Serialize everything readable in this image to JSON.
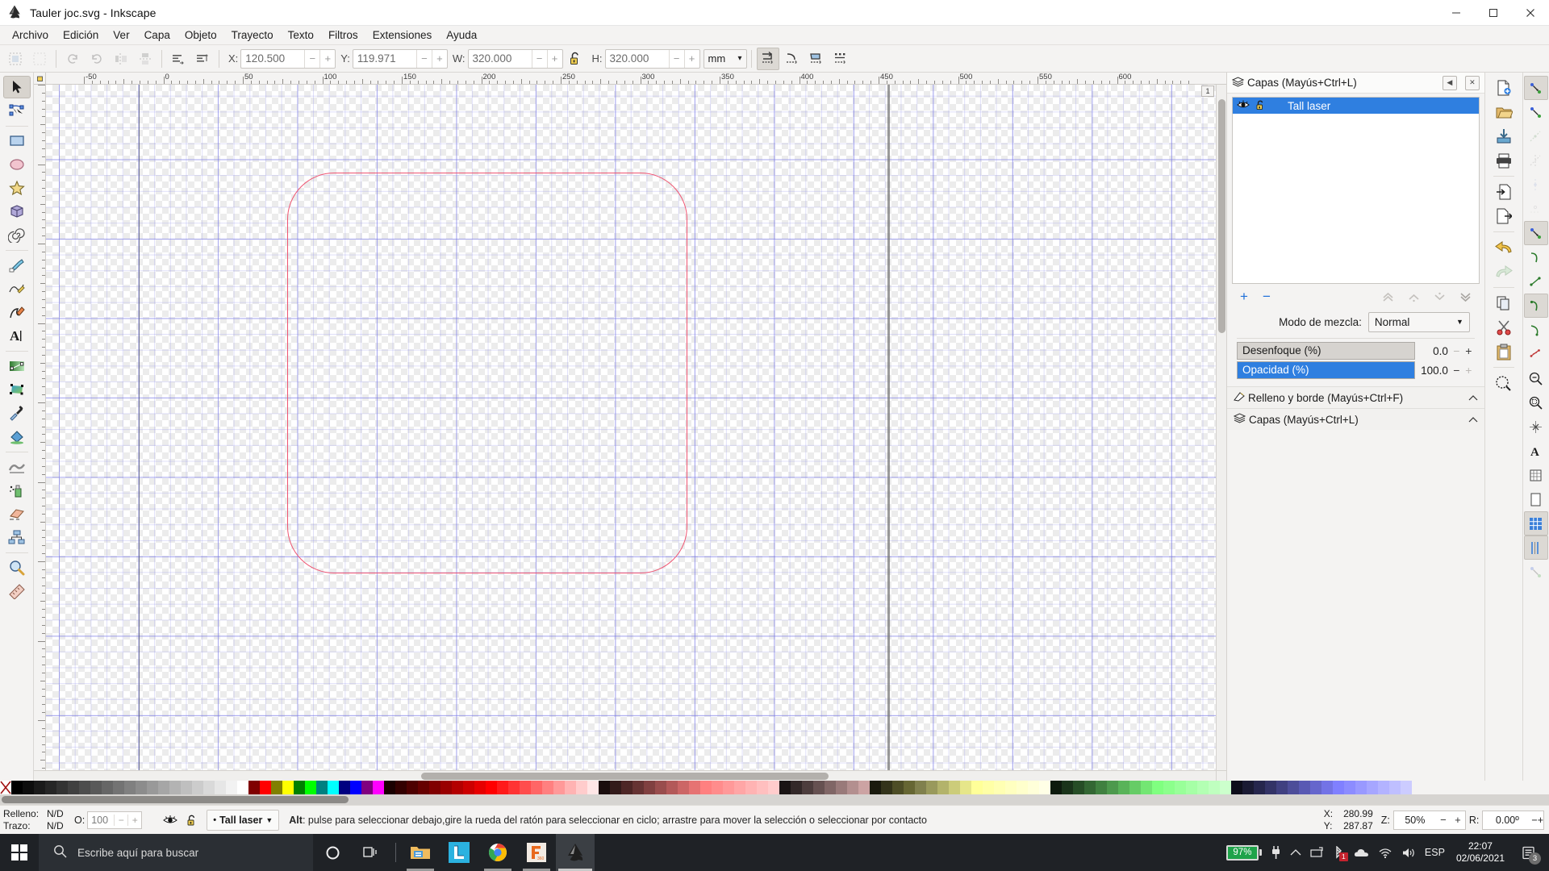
{
  "window": {
    "title": "Tauler joc.svg - Inkscape",
    "app_icon": "inkscape-logo-icon",
    "minimize": "—",
    "maximize": "▢",
    "close": "✕"
  },
  "menubar": {
    "items": [
      "Archivo",
      "Edición",
      "Ver",
      "Capa",
      "Objeto",
      "Trayecto",
      "Texto",
      "Filtros",
      "Extensiones",
      "Ayuda"
    ]
  },
  "toolcontrols": {
    "align_left_icon": "align-nodes-left-icon",
    "align_top_icon": "align-nodes-top-icon",
    "x_label": "X:",
    "x_value": "120.500",
    "y_label": "Y:",
    "y_value": "119.971",
    "w_label": "W:",
    "w_value": "320.000",
    "h_label": "H:",
    "h_value": "320.000",
    "lock_icon": "lock-open-icon",
    "units": "mm",
    "units_caret": "▾",
    "minus": "−",
    "plus": "+",
    "snap_buttons": [
      {
        "name": "snap-bounding-box-icon",
        "active": true
      },
      {
        "name": "snap-bbox-corner-icon",
        "active": false
      },
      {
        "name": "snap-bbox-edge-icon",
        "active": false
      },
      {
        "name": "snap-bbox-midpoint-icon",
        "active": false
      }
    ]
  },
  "toolbox": {
    "tools": [
      {
        "name": "selector-tool",
        "icon": "arrow-cursor-icon",
        "selected": true
      },
      {
        "name": "node-tool",
        "icon": "node-editor-icon",
        "selected": false
      },
      {
        "name": "rectangle-tool",
        "icon": "rectangle-icon",
        "selected": false
      },
      {
        "name": "ellipse-tool",
        "icon": "ellipse-icon",
        "selected": false
      },
      {
        "name": "star-tool",
        "icon": "star-icon",
        "selected": false
      },
      {
        "name": "box3d-tool",
        "icon": "cube-3d-icon",
        "selected": false
      },
      {
        "name": "spiral-tool",
        "icon": "spiral-icon",
        "selected": false
      },
      {
        "name": "pencil-tool",
        "icon": "pencil-icon",
        "selected": false
      },
      {
        "name": "bezier-tool",
        "icon": "bezier-pen-icon",
        "selected": false
      },
      {
        "name": "calligraphy-tool",
        "icon": "calligraphy-pen-icon",
        "selected": false
      },
      {
        "name": "text-tool",
        "icon": "text-A-icon",
        "selected": false
      },
      {
        "name": "gradient-tool",
        "icon": "gradient-icon",
        "selected": false
      },
      {
        "name": "mesh-tool",
        "icon": "mesh-gradient-icon",
        "selected": false
      },
      {
        "name": "dropper-tool",
        "icon": "eyedropper-icon",
        "selected": false
      },
      {
        "name": "paintbucket-tool",
        "icon": "paint-bucket-icon",
        "selected": false
      },
      {
        "name": "tweak-tool",
        "icon": "tweak-wave-icon",
        "selected": false
      },
      {
        "name": "spray-tool",
        "icon": "spray-can-icon",
        "selected": false
      },
      {
        "name": "eraser-tool",
        "icon": "eraser-icon",
        "selected": false
      },
      {
        "name": "connector-tool",
        "icon": "connector-diagram-icon",
        "selected": false
      },
      {
        "name": "zoom-tool",
        "icon": "magnifier-icon",
        "selected": false
      },
      {
        "name": "measure-tool",
        "icon": "ruler-measure-icon",
        "selected": false
      }
    ]
  },
  "rulers": {
    "horizontal_labels": [
      "-50",
      "0",
      "50",
      "100",
      "150",
      "200",
      "250",
      "300",
      "350",
      "400",
      "450",
      "500",
      "550",
      "600"
    ],
    "vertical_labels": [
      "0",
      "50",
      "100",
      "150",
      "200",
      "250",
      "300",
      "350",
      "400"
    ],
    "page_number_badge": "1"
  },
  "canvas": {
    "shape_name": "rounded-rectangle-path",
    "shape_stroke": "#ef5571",
    "grid_color": "#7878e6"
  },
  "layers_panel": {
    "title": "Capas (Mayús+Ctrl+L)",
    "title_icon": "layers-stack-icon",
    "dock_float_icon": "◀",
    "dock_close_icon": "✕",
    "rows": [
      {
        "name": "Tall laser",
        "visible_icon": "eye-open-icon",
        "lock_icon": "lock-open-icon",
        "selected": true
      }
    ],
    "add_layer": "+",
    "remove_layer": "−",
    "raise_to_top_icon": "layer-top-icon",
    "raise_icon": "layer-up-icon",
    "lower_icon": "layer-down-icon",
    "lower_to_bottom_icon": "layer-bottom-icon",
    "blend_label": "Modo de mezcla:",
    "blend_value": "Normal",
    "blend_caret": "▼",
    "blur": {
      "label": "Desenfoque (%)",
      "value": "0.0",
      "percent": 0,
      "minus": "−",
      "plus": "+"
    },
    "opacity": {
      "label": "Opacidad (%)",
      "value": "100.0",
      "percent": 100,
      "minus": "−",
      "plus": "+"
    }
  },
  "collapsed_dialogs": [
    {
      "label": "Relleno y borde (Mayús+Ctrl+F)",
      "icon": "fill-stroke-icon",
      "caret": "⌃"
    },
    {
      "label": "Capas (Mayús+Ctrl+L)",
      "icon": "layers-stack-icon",
      "caret": "⌃"
    }
  ],
  "command_strip": {
    "buttons": [
      {
        "name": "new-document-icon",
        "dim": false
      },
      {
        "name": "open-document-icon",
        "dim": false
      },
      {
        "name": "save-document-icon",
        "dim": false
      },
      {
        "name": "print-document-icon",
        "dim": false
      },
      {
        "name": "import-icon",
        "dim": false
      },
      {
        "name": "export-icon",
        "dim": false
      },
      {
        "name": "undo-icon",
        "dim": false
      },
      {
        "name": "redo-icon",
        "dim": true
      },
      {
        "name": "copy-icon",
        "dim": false
      },
      {
        "name": "cut-scissors-icon",
        "dim": false
      },
      {
        "name": "paste-clipboard-icon",
        "dim": false
      },
      {
        "name": "zoom-selection-icon",
        "dim": false
      }
    ]
  },
  "snap_strip": {
    "buttons": [
      {
        "name": "snap-enable-icon",
        "on": true
      },
      {
        "name": "snap-node-icon",
        "on": false
      },
      {
        "name": "snap-path-icon",
        "on": false,
        "dim": true
      },
      {
        "name": "snap-path-intersection-icon",
        "on": false,
        "dim": true
      },
      {
        "name": "snap-cusp-node-icon",
        "on": false,
        "dim": true
      },
      {
        "name": "snap-smooth-node-icon",
        "on": false,
        "dim": true
      },
      {
        "name": "snap-object-midpoint-icon",
        "on": true
      },
      {
        "name": "snap-bbox-icon",
        "on": false
      },
      {
        "name": "snap-path-edge-icon",
        "on": false
      },
      {
        "name": "snap-rotation-center-icon",
        "on": true
      },
      {
        "name": "snap-text-baseline-icon",
        "on": false
      },
      {
        "name": "snap-page-border-icon",
        "on": false
      },
      {
        "name": "snap-grid-icon",
        "on": true
      },
      {
        "name": "snap-guide-icon",
        "on": true
      },
      {
        "name": "snap-grid-guide-icon",
        "on": false
      },
      {
        "name": "snap-bbox-edge-midpoint-icon",
        "on": false
      },
      {
        "name": "snap-expand-icon",
        "on": false
      }
    ]
  },
  "palette": {
    "x_swatch": "none-swatch",
    "colors": [
      "#000000",
      "#0d0d0d",
      "#1a1a1a",
      "#262626",
      "#333333",
      "#404040",
      "#4d4d4d",
      "#595959",
      "#666666",
      "#737373",
      "#808080",
      "#8c8c8c",
      "#999999",
      "#a6a6a6",
      "#b3b3b3",
      "#bfbfbf",
      "#cccccc",
      "#d9d9d9",
      "#e6e6e6",
      "#f2f2f2",
      "#ffffff",
      "#800000",
      "#ff0000",
      "#808000",
      "#ffff00",
      "#008000",
      "#00ff00",
      "#008080",
      "#00ffff",
      "#000080",
      "#0000ff",
      "#800080",
      "#ff00ff",
      "#1a0000",
      "#330000",
      "#4d0000",
      "#660000",
      "#800000",
      "#990000",
      "#b30000",
      "#cc0000",
      "#e60000",
      "#ff0000",
      "#ff1a1a",
      "#ff3333",
      "#ff4d4d",
      "#ff6666",
      "#ff8080",
      "#ff9999",
      "#ffb3b3",
      "#ffcccc",
      "#ffe6e6",
      "#1a0d0d",
      "#331a1a",
      "#4d2626",
      "#663333",
      "#804040",
      "#994d4d",
      "#b35959",
      "#cc6666",
      "#e67373",
      "#ff8080",
      "#ff8c8c",
      "#ff9999",
      "#ffa6a6",
      "#ffb3b3",
      "#ffbfbf",
      "#ffcccc",
      "#1a1414",
      "#332828",
      "#4d3d3d",
      "#665151",
      "#806666",
      "#997a7a",
      "#b38f8f",
      "#cca3a3",
      "#1a1a0d",
      "#33331a",
      "#4d4d26",
      "#666633",
      "#80804d",
      "#99995c",
      "#b3b36b",
      "#cccc7a",
      "#e6e68a",
      "#ffff99",
      "#ffffa6",
      "#ffffb3",
      "#ffffc0",
      "#ffffcc",
      "#ffffd9",
      "#ffffe6",
      "#0d1a0d",
      "#1a331a",
      "#264d26",
      "#336633",
      "#408040",
      "#4d994d",
      "#59b359",
      "#66cc66",
      "#73e673",
      "#80ff80",
      "#8cff8c",
      "#99ff99",
      "#a6ffa6",
      "#b3ffb3",
      "#bfffbf",
      "#ccffcc",
      "#0d0d1a",
      "#1a1a33",
      "#26264d",
      "#333366",
      "#404080",
      "#4d4d99",
      "#5959b3",
      "#6666cc",
      "#7373e6",
      "#8080ff",
      "#8c8cff",
      "#9999ff",
      "#a6a6ff",
      "#b3b3ff",
      "#bfbfff",
      "#ccccff"
    ]
  },
  "statusbar": {
    "fill_label": "Relleno:",
    "fill_value": "N/D",
    "stroke_label": "Trazo:",
    "stroke_value": "N/D",
    "opacity_label": "O:",
    "opacity_value": "100",
    "opacity_minus": "−",
    "opacity_plus": "+",
    "eye_icon": "eye-open-icon",
    "lock_icon": "lock-open-icon",
    "layer_bullet": "•",
    "layer_name": "Tall laser",
    "layer_caret": "▼",
    "message_bold": "Alt",
    "message": ": pulse para seleccionar debajo,gire la rueda del ratón para seleccionar en ciclo; arrastre para mover la selección o seleccionar por contacto",
    "coord_x_label": "X:",
    "coord_x_value": "280.99",
    "coord_y_label": "Y:",
    "coord_y_value": "287.87",
    "zoom_label": "Z:",
    "zoom_value": "50%",
    "zoom_minus": "−",
    "zoom_plus": "+",
    "rotation_label": "R:",
    "rotation_value": "0.00º",
    "rotation_minus": "−",
    "rotation_plus": "+"
  },
  "taskbar": {
    "start_icon": "windows-start-icon",
    "search_icon": "search-icon",
    "search_placeholder": "Escribe aquí para buscar",
    "cortana_icon": "cortana-circle-icon",
    "taskview_icon": "task-view-icon",
    "apps": [
      {
        "name": "file-explorer-icon",
        "open": true
      },
      {
        "name": "lightburn-icon",
        "open": false
      },
      {
        "name": "google-chrome-icon",
        "open": true
      },
      {
        "name": "fusion360-icon",
        "open": true
      },
      {
        "name": "inkscape-icon",
        "open": true,
        "active": true
      }
    ],
    "tray": {
      "battery_percent": "97%",
      "power_icon": "power-plug-icon",
      "chevron_icon": "chevron-up-icon",
      "hardware_icon": "safely-remove-icon",
      "bluetooth_icon": "bluetooth-icon",
      "bluetooth_badge": "1",
      "onedrive_icon": "onedrive-cloud-icon",
      "wifi_icon": "wifi-icon",
      "volume_icon": "speaker-icon",
      "language": "ESP",
      "time": "22:07",
      "date": "02/06/2021",
      "notification_icon": "action-center-icon",
      "notification_count": "3"
    }
  }
}
